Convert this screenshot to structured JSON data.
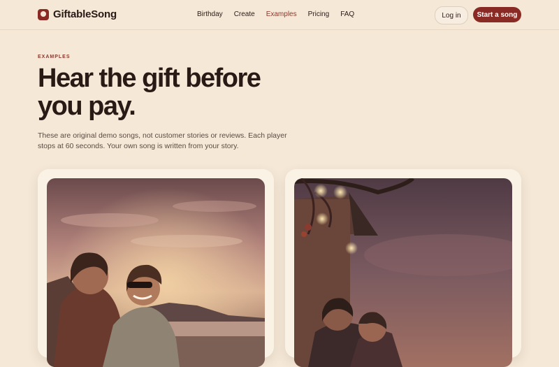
{
  "brand": {
    "name": "GiftableSong"
  },
  "nav": {
    "items": [
      {
        "label": "Birthday",
        "active": false
      },
      {
        "label": "Create",
        "active": false
      },
      {
        "label": "Examples",
        "active": true
      },
      {
        "label": "Pricing",
        "active": false
      },
      {
        "label": "FAQ",
        "active": false
      }
    ],
    "login_label": "Log in",
    "cta_label": "Start a song"
  },
  "hero": {
    "eyebrow": "EXAMPLES",
    "title": "Hear the gift before you pay.",
    "description": "These are original demo songs, not customer stories or reviews. Each player stops at 60 seconds. Your own song is written from your story."
  },
  "cards": [
    {
      "image": "two friends laughing at sunset by the sea"
    },
    {
      "image": "couple under string lights at dusk"
    }
  ],
  "colors": {
    "accent": "#8a2a24",
    "background": "#f5e8d7",
    "active_nav": "#8a3a2e"
  }
}
